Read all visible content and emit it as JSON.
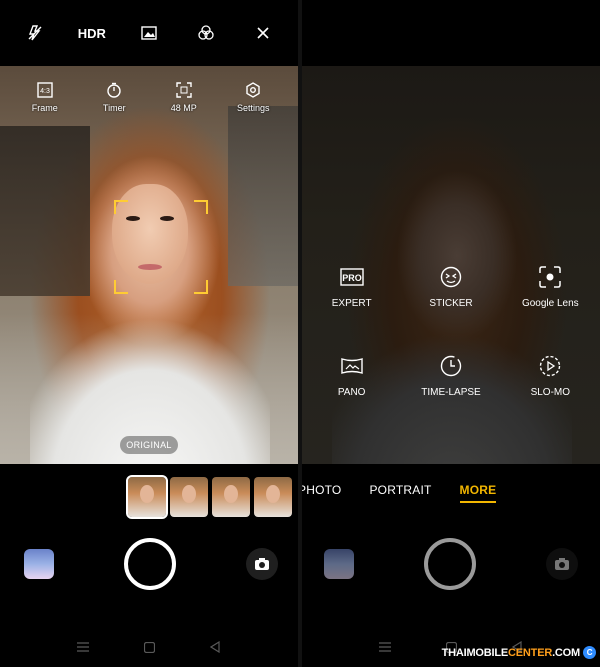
{
  "left": {
    "topbar": {
      "flash_icon": "flash-off-icon",
      "hdr_label": "HDR",
      "photo_ratio_icon": "image-icon",
      "filters_icon": "filters-icon",
      "close_icon": "close-icon"
    },
    "quick_settings": [
      {
        "label": "Frame",
        "icon": "frame-icon"
      },
      {
        "label": "Timer",
        "icon": "timer-icon"
      },
      {
        "label": "48 MP",
        "icon": "resolution-icon"
      },
      {
        "label": "Settings",
        "icon": "settings-icon"
      }
    ],
    "filter_label": "ORIGINAL",
    "filter_thumbnails": [
      {
        "name": "original",
        "selected": true
      },
      {
        "name": "filter-2",
        "selected": false
      },
      {
        "name": "filter-3",
        "selected": false
      },
      {
        "name": "filter-4",
        "selected": false
      }
    ]
  },
  "right": {
    "modes": [
      [
        {
          "label": "EXPERT",
          "icon": "pro-icon"
        },
        {
          "label": "STICKER",
          "icon": "sticker-icon"
        },
        {
          "label": "Google Lens",
          "icon": "google-lens-icon"
        }
      ],
      [
        {
          "label": "PANO",
          "icon": "panorama-icon"
        },
        {
          "label": "TIME-LAPSE",
          "icon": "time-lapse-icon"
        },
        {
          "label": "SLO-MO",
          "icon": "slow-motion-icon"
        }
      ]
    ],
    "mode_tabs": [
      {
        "label": "PHOTO",
        "active": false
      },
      {
        "label": "PORTRAIT",
        "active": false
      },
      {
        "label": "MORE",
        "active": true
      }
    ]
  },
  "colors": {
    "accent": "#f2b600",
    "focus": "#ffcc33"
  },
  "watermark": {
    "part1": "THAIMOBILE",
    "part2": "CENTER",
    "part3": ".COM",
    "badge": "C"
  }
}
